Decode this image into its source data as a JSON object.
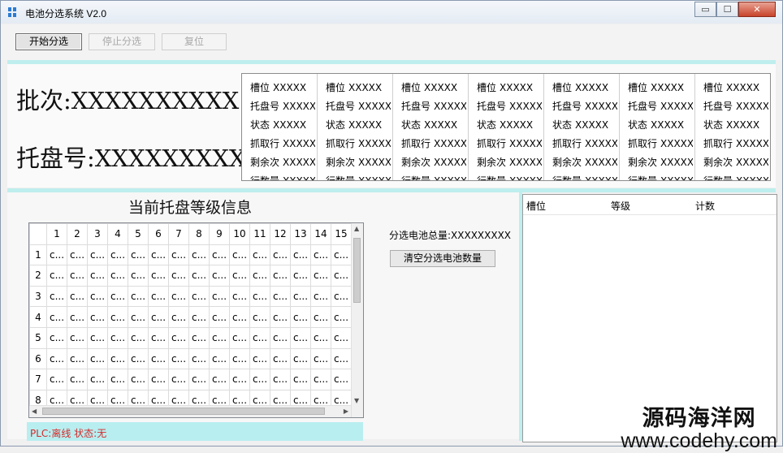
{
  "window": {
    "title": "电池分选系统 V2.0",
    "controls": [
      "▭",
      "☐",
      "✕"
    ]
  },
  "toolbar": {
    "start_label": "开始分选",
    "stop_label": "停止分选",
    "reset_label": "复位"
  },
  "batch": {
    "batch_label": "批次:XXXXXXXXXX",
    "tray_label": "托盘号:XXXXXXXXXX"
  },
  "slots": {
    "count": 7,
    "rows": [
      {
        "key": "槽位",
        "value": "XXXXX"
      },
      {
        "key": "托盘号",
        "value": "XXXXX"
      },
      {
        "key": "状态",
        "value": "XXXXX"
      },
      {
        "key": "抓取行",
        "value": "XXXXX"
      },
      {
        "key": "剩余次",
        "value": "XXXXX"
      },
      {
        "key": "行数量",
        "value": "XXXXX"
      }
    ]
  },
  "grid": {
    "title": "当前托盘等级信息",
    "col_headers": [
      "1",
      "2",
      "3",
      "4",
      "5",
      "6",
      "7",
      "8",
      "9",
      "10",
      "11",
      "12",
      "13",
      "14",
      "15"
    ],
    "row_headers": [
      "1",
      "2",
      "3",
      "4",
      "5",
      "6",
      "7",
      "8"
    ],
    "cell_text": "c..."
  },
  "total_label": "分选电池总量:XXXXXXXXX",
  "clear_button_label": "清空分选电池数量",
  "status": {
    "text": "PLC:离线  状态:无"
  },
  "listview": {
    "columns": [
      "槽位",
      "等级",
      "计数"
    ]
  },
  "watermark": {
    "line1": "源码海洋网",
    "line2": "www.codehy.com"
  },
  "colors": {
    "accent_separator": "#bfeeee",
    "status_text": "#d42a2a",
    "status_bg": "#b8eef0"
  }
}
